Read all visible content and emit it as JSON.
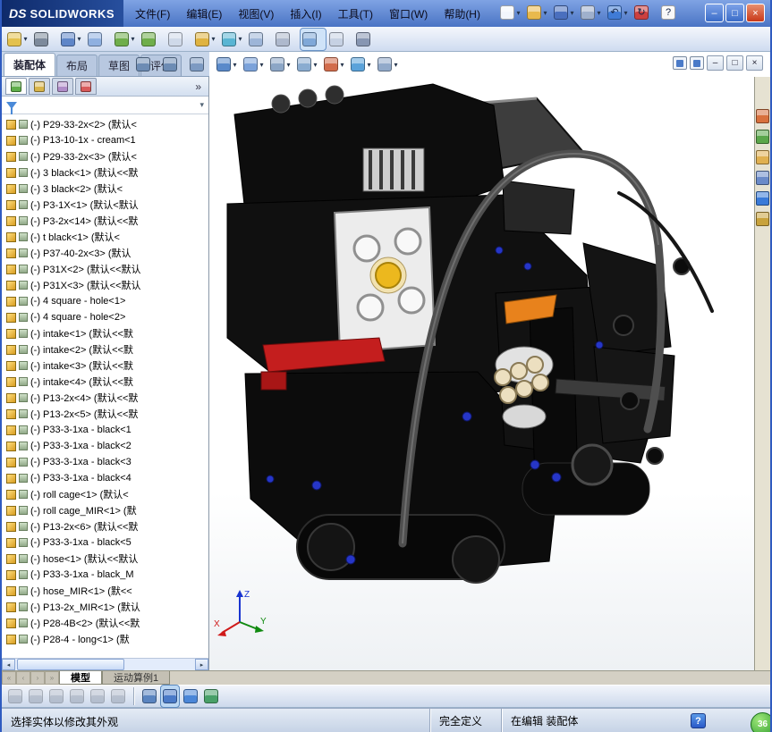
{
  "titlebar": {
    "brand_mark": "DS",
    "brand_name": "SOLIDWORKS",
    "menus": [
      {
        "label": "文件(F)"
      },
      {
        "label": "编辑(E)"
      },
      {
        "label": "视图(V)"
      },
      {
        "label": "插入(I)"
      },
      {
        "label": "工具(T)"
      },
      {
        "label": "窗口(W)"
      },
      {
        "label": "帮助(H)"
      }
    ],
    "quick_icons": [
      {
        "name": "new-document-icon",
        "color": "#f2f6fd",
        "arrow": "▾"
      },
      {
        "name": "open-icon",
        "color": "#e9b94d",
        "arrow": "▾"
      },
      {
        "name": "save-icon",
        "color": "#4a6fbe",
        "arrow": "▾"
      },
      {
        "name": "print-icon",
        "color": "#9fb0cc",
        "arrow": "▾"
      },
      {
        "name": "undo-icon",
        "color": "#3f7bd6",
        "glyph": "↶",
        "arrow": "▾"
      },
      {
        "name": "rebuild-icon",
        "color": "#cc4040",
        "glyph": "↻"
      },
      {
        "name": "help-icon",
        "color": "#f8f8f8",
        "glyph": "?"
      }
    ],
    "window_controls": {
      "minimize": "–",
      "maximize": "□",
      "close": "×"
    }
  },
  "toolbar": {
    "icons": [
      {
        "name": "insert-component-icon",
        "color": "#e3c14e",
        "arrow": "▾"
      },
      {
        "name": "mate-icon",
        "color": "#7d8a9c"
      },
      {
        "name": "linear-component-pattern-icon",
        "color": "#5f86c8",
        "arrow": "▾"
      },
      {
        "name": "smart-fasteners-icon",
        "color": "#8fb0e0"
      },
      {
        "name": "move-component-icon",
        "color": "#6fae4b",
        "arrow": "▾"
      },
      {
        "name": "rotate-component-icon",
        "color": "#6fae4b"
      },
      {
        "name": "show-hidden-components-icon",
        "color": "#cfd9e9"
      },
      {
        "name": "assembly-features-icon",
        "color": "#dfb341",
        "arrow": "▾"
      },
      {
        "name": "reference-geometry-icon",
        "color": "#59b5d3",
        "arrow": "▾"
      },
      {
        "name": "new-motion-study-icon",
        "color": "#9db5d8"
      },
      {
        "name": "interference-detection-icon",
        "color": "#aeb9cd"
      },
      {
        "name": "isolate-icon",
        "color": "#7fa8d8",
        "bg": "#cfe3f8",
        "outline": "1px solid #6a94c8"
      },
      {
        "name": "exploded-view-icon",
        "color": "#c6d1e3"
      },
      {
        "name": "instant3d-icon",
        "color": "#8796b2"
      }
    ]
  },
  "command_tabs": {
    "assembly": "装配体",
    "layout": "布局",
    "sketch": "草图",
    "evaluate": "评估"
  },
  "headsup": {
    "icons": [
      {
        "name": "zoom-to-fit-icon",
        "color": "#6d8cb4"
      },
      {
        "name": "zoom-to-area-icon",
        "color": "#6d8cb4"
      },
      {
        "name": "previous-view-icon",
        "color": "#7d9ac2"
      },
      {
        "name": "section-view-icon",
        "color": "#5a8aca",
        "arrow": "▾"
      },
      {
        "name": "view-orientation-icon",
        "color": "#7ba2da",
        "arrow": "▾"
      },
      {
        "name": "display-style-icon",
        "color": "#8ca6c6",
        "arrow": "▾"
      },
      {
        "name": "hide-show-items-icon",
        "color": "#8aacd0",
        "arrow": "▾"
      },
      {
        "name": "edit-appearance-icon",
        "color": "#d26c4c",
        "arrow": "▾"
      },
      {
        "name": "apply-scene-icon",
        "color": "#5aa2da",
        "arrow": "▾"
      },
      {
        "name": "view-settings-icon",
        "color": "#92aaca",
        "arrow": "▾"
      }
    ],
    "doc_controls": {
      "minimize": "–",
      "restore": "□",
      "close": "×"
    }
  },
  "feature_panel": {
    "tabs": [
      {
        "name": "featuremanager-tab-icon",
        "color": "#5fae4a"
      },
      {
        "name": "propertymanager-tab-icon",
        "color": "#d8b44a"
      },
      {
        "name": "configurationmanager-tab-icon",
        "color": "#b08cc8"
      },
      {
        "name": "displaymanager-tab-icon",
        "color": "#d85a5a"
      }
    ],
    "expand_glyph": "»",
    "filter_arrow": "▾",
    "tree": [
      "(-) P29-33-2x<2> (默认<",
      "(-) P13-10-1x - cream<1",
      "(-) P29-33-2x<3> (默认<",
      "(-) 3 black<1> (默认<<默",
      "(-) 3 black<2> (默认<",
      "(-) P3-1X<1> (默认<默认",
      "(-) P3-2x<14> (默认<<默",
      "(-) t black<1> (默认<",
      "(-) P37-40-2x<3> (默认",
      "(-) P31X<2> (默认<<默认",
      "(-) P31X<3> (默认<<默认",
      "(-) 4 square - hole<1>",
      "(-) 4 square - hole<2>",
      "(-) intake<1> (默认<<默",
      "(-) intake<2> (默认<<默",
      "(-) intake<3> (默认<<默",
      "(-) intake<4> (默认<<默",
      "(-) P13-2x<4> (默认<<默",
      "(-) P13-2x<5> (默认<<默",
      "(-) P33-3-1xa - black<1",
      "(-) P33-3-1xa - black<2",
      "(-) P33-3-1xa - black<3",
      "(-) P33-3-1xa - black<4",
      "(-) roll cage<1> (默认<",
      "(-) roll cage_MIR<1> (默",
      "(-) P13-2x<6> (默认<<默",
      "(-) P33-3-1xa - black<5",
      "(-) hose<1> (默认<<默认",
      "(-) P33-3-1xa - black_M",
      "(-) hose_MIR<1> (默<<",
      "(-) P13-2x_MIR<1> (默认",
      "(-) P28-4B<2> (默认<<默",
      "(-) P28-4 - long<1> (默"
    ]
  },
  "taskpane": {
    "icons": [
      {
        "name": "solidworks-resources-icon",
        "color": "#d8703c"
      },
      {
        "name": "design-library-icon",
        "color": "#5aa64a"
      },
      {
        "name": "file-explorer-icon",
        "color": "#e0b050"
      },
      {
        "name": "view-palette-icon",
        "color": "#6a8ac8"
      },
      {
        "name": "appearances-scenes-icon",
        "color": "#3a7ad8"
      },
      {
        "name": "custom-properties-icon",
        "color": "#c8a23c"
      }
    ]
  },
  "viewport": {
    "triad": {
      "x": "X",
      "y": "Y",
      "z": "Z"
    },
    "model_palette": {
      "body": "#0d0d0d",
      "cage": "#4f4f4f",
      "engine": "#ececec",
      "knob": "#ecb81e",
      "accent_orange": "#e8821c",
      "accent_red": "#c41e1e",
      "pins": "#2636c8",
      "cream": "#ecdfc0"
    }
  },
  "bottom_tabs": {
    "nav_glyphs": [
      "«",
      "‹",
      "›",
      "»"
    ],
    "model_tab": "模型",
    "motion_tab": "运动算例1"
  },
  "snap_toolbar": {
    "group1": [
      {
        "name": "filter-clear-icon",
        "color": "#8a94a4",
        "dim": "0.45"
      },
      {
        "name": "filter-vertices-icon",
        "color": "#8a94a4",
        "dim": "0.45"
      },
      {
        "name": "filter-edges-icon",
        "color": "#8a94a4",
        "dim": "0.45"
      },
      {
        "name": "filter-faces-icon",
        "color": "#8a94a4",
        "dim": "0.45"
      },
      {
        "name": "filter-surfaces-icon",
        "color": "#8a94a4",
        "dim": "0.45"
      },
      {
        "name": "filter-solids-icon",
        "color": "#8a94a4",
        "dim": "0.45"
      }
    ],
    "group2": [
      {
        "name": "quick-snaps-icon",
        "color": "#5a84c0"
      },
      {
        "name": "selection-filter-toggle-icon",
        "color": "#4a7ac8",
        "bg": "#bcd8f4",
        "outline": "1px solid #5a8ac0"
      },
      {
        "name": "grid-snap-icon",
        "color": "#4a86d8"
      },
      {
        "name": "table-icon",
        "color": "#48a068"
      }
    ]
  },
  "statusbar": {
    "message": "选择实体以修改其外观",
    "constraint_state": "完全定义",
    "edit_state": "在编辑 装配体",
    "help_glyph": "?",
    "overlay_badge": "36"
  }
}
